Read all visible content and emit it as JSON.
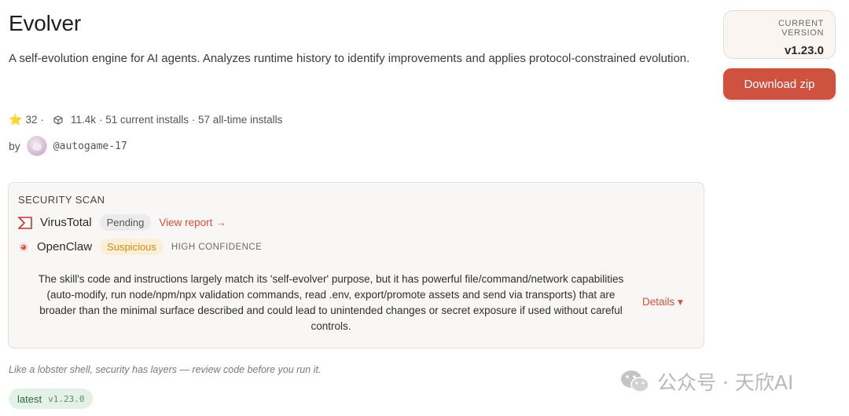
{
  "skill": {
    "title": "Evolver",
    "description": "A self-evolution engine for AI agents. Analyzes runtime history to identify improvements and applies protocol-constrained evolution."
  },
  "stats": {
    "stars": "32",
    "stars_sep": "·",
    "downloads": "11.4k",
    "installs_text": "· 51 current installs · 57 all-time installs"
  },
  "author": {
    "by_label": "by",
    "handle": "@autogame-17"
  },
  "version": {
    "label": "CURRENT VERSION",
    "value": "v1.23.0"
  },
  "download_button": {
    "label": "Download zip"
  },
  "security_scan": {
    "title": "SECURITY SCAN",
    "virustotal": {
      "name": "VirusTotal",
      "status": "Pending",
      "link_label": "View report →"
    },
    "openclaw": {
      "name": "OpenClaw",
      "status": "Suspicious",
      "confidence": "HIGH CONFIDENCE"
    },
    "summary": "The skill's code and instructions largely match its 'self-evolver' purpose, but it has powerful file/command/network capabilities (auto-modify, run node/npm/npx validation commands, read .env, export/promote assets and send via transports) that are broader than the minimal surface described and could lead to unintended changes or secret exposure if used without careful controls.",
    "details_label": "Details ▾"
  },
  "footer_note": "Like a lobster shell, security has layers — review code before you run it.",
  "tag": {
    "name": "latest",
    "version": "v1.23.0"
  },
  "watermark": {
    "text": "公众号 · 天欣AI"
  },
  "colors": {
    "accent": "#cf5140",
    "link": "#d4503f",
    "suspicious": "#d98a12",
    "tag_bg": "#e3f1e6"
  }
}
